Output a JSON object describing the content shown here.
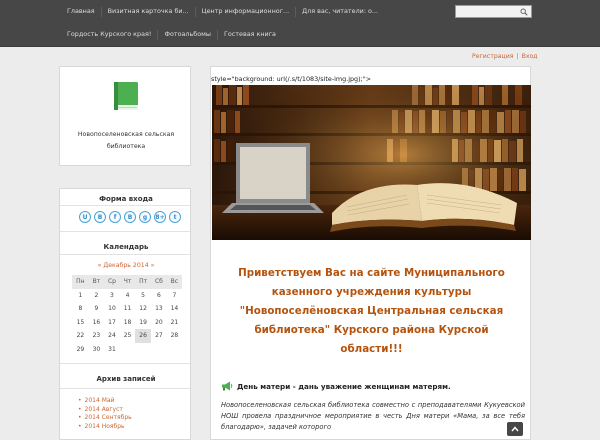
{
  "nav": {
    "row1": [
      "Главная",
      "Визитная карточка би...",
      "Центр информационног...",
      "Для вас, читатели: о..."
    ],
    "row2": [
      "Гордость Курского края!",
      "Фотоальбомы",
      "Гостевая книга"
    ]
  },
  "search": {
    "value": ""
  },
  "auth": {
    "register": "Регистрация",
    "sep": "|",
    "login": "Вход"
  },
  "sidebar": {
    "logo_text": "Новопоселеновская сельская библиотека",
    "login_title": "Форма входа",
    "social": [
      "U",
      "В",
      "f",
      "В",
      "g",
      "8+",
      "t"
    ],
    "calendar_title": "Календарь",
    "calendar_nav": "« Декабрь 2014 »",
    "weekdays": [
      "Пн",
      "Вт",
      "Ср",
      "Чт",
      "Пт",
      "Сб",
      "Вс"
    ],
    "weeks": [
      [
        "1",
        "2",
        "3",
        "4",
        "5",
        "6",
        "7"
      ],
      [
        "8",
        "9",
        "10",
        "11",
        "12",
        "13",
        "14"
      ],
      [
        "15",
        "16",
        "17",
        "18",
        "19",
        "20",
        "21"
      ],
      [
        "22",
        "23",
        "24",
        "25",
        "26",
        "27",
        "28"
      ],
      [
        "29",
        "30",
        "31",
        "",
        "",
        "",
        ""
      ]
    ],
    "archive_title": "Архив записей",
    "archive": [
      "2014 Май",
      "2014 Август",
      "2014 Сентябрь",
      "2014 Ноябрь"
    ]
  },
  "main": {
    "code_line": "style=\"background: url(/.s/t/1083/site-img.jpg);\">",
    "greeting": "Приветствуем Вас на сайте Муниципального казенного учреждения культуры \"Новопоселёновская Центральная сельская библиотека\" Курского района Курской области!!!",
    "news_title": "День матери - дань уважение женщинам матерям.",
    "news_body": "Новопоселеновская сельская библиотека совместно с преподавателями Кукуевской НОШ провела праздничное мероприятие в честь Дня матери «Мама, за все тебя благодарю», задачей которого"
  },
  "colors": {
    "accent": "#cc6633",
    "heading": "#b5530e",
    "nav_bg": "#474747"
  }
}
